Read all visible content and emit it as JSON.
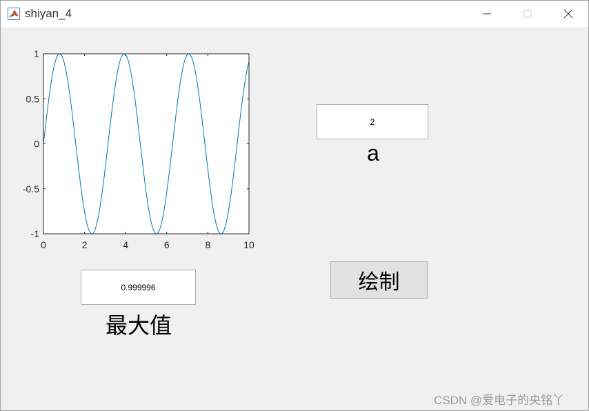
{
  "window": {
    "title": "shiyan_4"
  },
  "controls": {
    "a_value": "2",
    "a_label": "a",
    "max_value": "0.999996",
    "max_label": "最大值",
    "draw_label": "绘制"
  },
  "watermark": "CSDN @爱电子的央铭丫",
  "colors": {
    "line": "#0072bd",
    "axes": "#262626"
  },
  "chart_data": {
    "type": "line",
    "title": "",
    "xlabel": "",
    "ylabel": "",
    "xlim": [
      0,
      10
    ],
    "ylim": [
      -1,
      1
    ],
    "xticks": [
      0,
      2,
      4,
      6,
      8,
      10
    ],
    "yticks": [
      1,
      0.5,
      0,
      -0.5,
      -1
    ],
    "xtick_labels": [
      "0",
      "2",
      "4",
      "6",
      "8",
      "10"
    ],
    "ytick_labels": [
      "1",
      "0.5",
      "0",
      "-0.5",
      "-1"
    ],
    "grid": false,
    "series": [
      {
        "function": "sin(a*x)",
        "a": 2,
        "x_start": 0,
        "x_end": 10
      }
    ]
  }
}
